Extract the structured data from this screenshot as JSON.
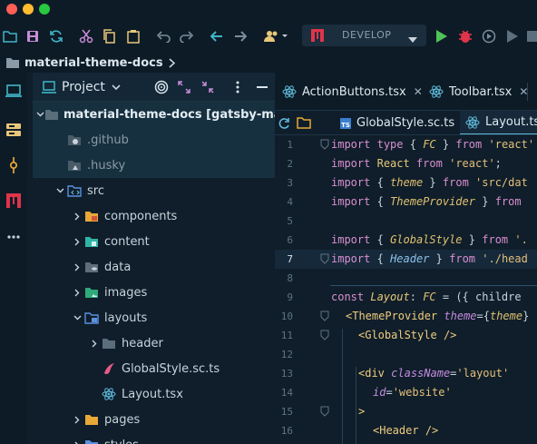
{
  "toolbar": {
    "run_config": "DEVELOP"
  },
  "breadcrumb": {
    "project": "material-theme-docs"
  },
  "project_panel": {
    "title": "Project",
    "tree": [
      {
        "name": "material-theme-docs [gatsby-mate",
        "depth": 0,
        "expanded": true,
        "icon": "folder-icon",
        "bold": true
      },
      {
        "name": ".github",
        "depth": 1,
        "icon": "github-folder-icon",
        "dim": true
      },
      {
        "name": ".husky",
        "depth": 1,
        "icon": "husky-folder-icon",
        "dim": true
      },
      {
        "name": "src",
        "depth": 1,
        "expanded": true,
        "icon": "src-folder-icon"
      },
      {
        "name": "components",
        "depth": 2,
        "icon": "components-folder-icon"
      },
      {
        "name": "content",
        "depth": 2,
        "icon": "content-folder-icon"
      },
      {
        "name": "data",
        "depth": 2,
        "icon": "data-folder-icon"
      },
      {
        "name": "images",
        "depth": 2,
        "icon": "images-folder-icon"
      },
      {
        "name": "layouts",
        "depth": 2,
        "expanded": true,
        "icon": "layouts-folder-icon"
      },
      {
        "name": "header",
        "depth": 3,
        "icon": "folder-icon"
      },
      {
        "name": "GlobalStyle.sc.ts",
        "depth": 3,
        "icon": "styled-components-icon"
      },
      {
        "name": "Layout.tsx",
        "depth": 3,
        "icon": "react-icon"
      },
      {
        "name": "pages",
        "depth": 2,
        "icon": "pages-folder-icon"
      },
      {
        "name": "styles",
        "depth": 2,
        "icon": "styles-folder-icon"
      }
    ]
  },
  "editor": {
    "tabs": [
      {
        "label": "ActionButtons.tsx",
        "close": "✕"
      },
      {
        "label": "Toolbar.tsx",
        "close": "✕"
      }
    ],
    "tabs2": [
      {
        "label": "GlobalStyle.sc.ts"
      },
      {
        "label": "Layout.ts"
      }
    ],
    "line_numbers": [
      "1",
      "2",
      "3",
      "4",
      "5",
      "6",
      "7",
      "8",
      "9",
      "10",
      "11",
      "12",
      "13",
      "14",
      "15",
      "16"
    ],
    "current_line": "7"
  },
  "colors": {
    "accent": "#5fb8d8",
    "background": "#0f1e2a",
    "run_green": "#4fc35a",
    "debug_red": "#e0344a"
  }
}
